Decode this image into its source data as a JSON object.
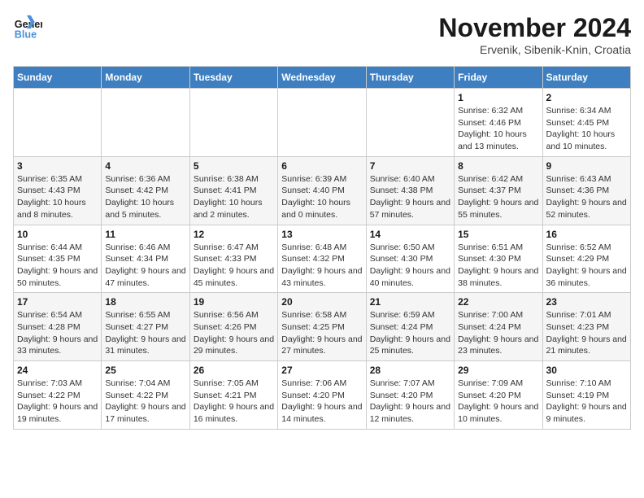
{
  "header": {
    "logo_line1": "General",
    "logo_line2": "Blue",
    "month_title": "November 2024",
    "location": "Ervenik, Sibenik-Knin, Croatia"
  },
  "weekdays": [
    "Sunday",
    "Monday",
    "Tuesday",
    "Wednesday",
    "Thursday",
    "Friday",
    "Saturday"
  ],
  "weeks": [
    [
      {
        "day": "",
        "info": ""
      },
      {
        "day": "",
        "info": ""
      },
      {
        "day": "",
        "info": ""
      },
      {
        "day": "",
        "info": ""
      },
      {
        "day": "",
        "info": ""
      },
      {
        "day": "1",
        "info": "Sunrise: 6:32 AM\nSunset: 4:46 PM\nDaylight: 10 hours and 13 minutes."
      },
      {
        "day": "2",
        "info": "Sunrise: 6:34 AM\nSunset: 4:45 PM\nDaylight: 10 hours and 10 minutes."
      }
    ],
    [
      {
        "day": "3",
        "info": "Sunrise: 6:35 AM\nSunset: 4:43 PM\nDaylight: 10 hours and 8 minutes."
      },
      {
        "day": "4",
        "info": "Sunrise: 6:36 AM\nSunset: 4:42 PM\nDaylight: 10 hours and 5 minutes."
      },
      {
        "day": "5",
        "info": "Sunrise: 6:38 AM\nSunset: 4:41 PM\nDaylight: 10 hours and 2 minutes."
      },
      {
        "day": "6",
        "info": "Sunrise: 6:39 AM\nSunset: 4:40 PM\nDaylight: 10 hours and 0 minutes."
      },
      {
        "day": "7",
        "info": "Sunrise: 6:40 AM\nSunset: 4:38 PM\nDaylight: 9 hours and 57 minutes."
      },
      {
        "day": "8",
        "info": "Sunrise: 6:42 AM\nSunset: 4:37 PM\nDaylight: 9 hours and 55 minutes."
      },
      {
        "day": "9",
        "info": "Sunrise: 6:43 AM\nSunset: 4:36 PM\nDaylight: 9 hours and 52 minutes."
      }
    ],
    [
      {
        "day": "10",
        "info": "Sunrise: 6:44 AM\nSunset: 4:35 PM\nDaylight: 9 hours and 50 minutes."
      },
      {
        "day": "11",
        "info": "Sunrise: 6:46 AM\nSunset: 4:34 PM\nDaylight: 9 hours and 47 minutes."
      },
      {
        "day": "12",
        "info": "Sunrise: 6:47 AM\nSunset: 4:33 PM\nDaylight: 9 hours and 45 minutes."
      },
      {
        "day": "13",
        "info": "Sunrise: 6:48 AM\nSunset: 4:32 PM\nDaylight: 9 hours and 43 minutes."
      },
      {
        "day": "14",
        "info": "Sunrise: 6:50 AM\nSunset: 4:30 PM\nDaylight: 9 hours and 40 minutes."
      },
      {
        "day": "15",
        "info": "Sunrise: 6:51 AM\nSunset: 4:30 PM\nDaylight: 9 hours and 38 minutes."
      },
      {
        "day": "16",
        "info": "Sunrise: 6:52 AM\nSunset: 4:29 PM\nDaylight: 9 hours and 36 minutes."
      }
    ],
    [
      {
        "day": "17",
        "info": "Sunrise: 6:54 AM\nSunset: 4:28 PM\nDaylight: 9 hours and 33 minutes."
      },
      {
        "day": "18",
        "info": "Sunrise: 6:55 AM\nSunset: 4:27 PM\nDaylight: 9 hours and 31 minutes."
      },
      {
        "day": "19",
        "info": "Sunrise: 6:56 AM\nSunset: 4:26 PM\nDaylight: 9 hours and 29 minutes."
      },
      {
        "day": "20",
        "info": "Sunrise: 6:58 AM\nSunset: 4:25 PM\nDaylight: 9 hours and 27 minutes."
      },
      {
        "day": "21",
        "info": "Sunrise: 6:59 AM\nSunset: 4:24 PM\nDaylight: 9 hours and 25 minutes."
      },
      {
        "day": "22",
        "info": "Sunrise: 7:00 AM\nSunset: 4:24 PM\nDaylight: 9 hours and 23 minutes."
      },
      {
        "day": "23",
        "info": "Sunrise: 7:01 AM\nSunset: 4:23 PM\nDaylight: 9 hours and 21 minutes."
      }
    ],
    [
      {
        "day": "24",
        "info": "Sunrise: 7:03 AM\nSunset: 4:22 PM\nDaylight: 9 hours and 19 minutes."
      },
      {
        "day": "25",
        "info": "Sunrise: 7:04 AM\nSunset: 4:22 PM\nDaylight: 9 hours and 17 minutes."
      },
      {
        "day": "26",
        "info": "Sunrise: 7:05 AM\nSunset: 4:21 PM\nDaylight: 9 hours and 16 minutes."
      },
      {
        "day": "27",
        "info": "Sunrise: 7:06 AM\nSunset: 4:20 PM\nDaylight: 9 hours and 14 minutes."
      },
      {
        "day": "28",
        "info": "Sunrise: 7:07 AM\nSunset: 4:20 PM\nDaylight: 9 hours and 12 minutes."
      },
      {
        "day": "29",
        "info": "Sunrise: 7:09 AM\nSunset: 4:20 PM\nDaylight: 9 hours and 10 minutes."
      },
      {
        "day": "30",
        "info": "Sunrise: 7:10 AM\nSunset: 4:19 PM\nDaylight: 9 hours and 9 minutes."
      }
    ]
  ]
}
